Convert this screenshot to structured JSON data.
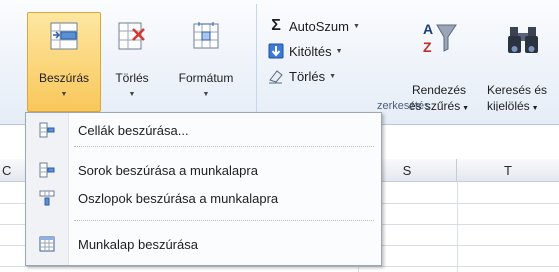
{
  "ribbon": {
    "cells_group": {
      "insert_label": "Beszúrás",
      "delete_label": "Törlés",
      "format_label": "Formátum"
    },
    "editing_group": {
      "autosum_label": "AutoSzum",
      "fill_label": "Kitöltés",
      "clear_label": "Törlés",
      "sort_label_1": "Rendezés",
      "sort_label_2": "és szűrés",
      "find_label_1": "Keresés és",
      "find_label_2": "kijelölés",
      "group_label": "zerkesztés"
    }
  },
  "menu": {
    "items": [
      {
        "label": "Cellák beszúrása..."
      },
      {
        "label": "Sorok beszúrása a munkalapra"
      },
      {
        "label": "Oszlopok beszúrása a munkalapra"
      },
      {
        "label": "Munkalap beszúrása"
      }
    ]
  },
  "sheet": {
    "columns": [
      "C",
      "S",
      "T"
    ]
  }
}
